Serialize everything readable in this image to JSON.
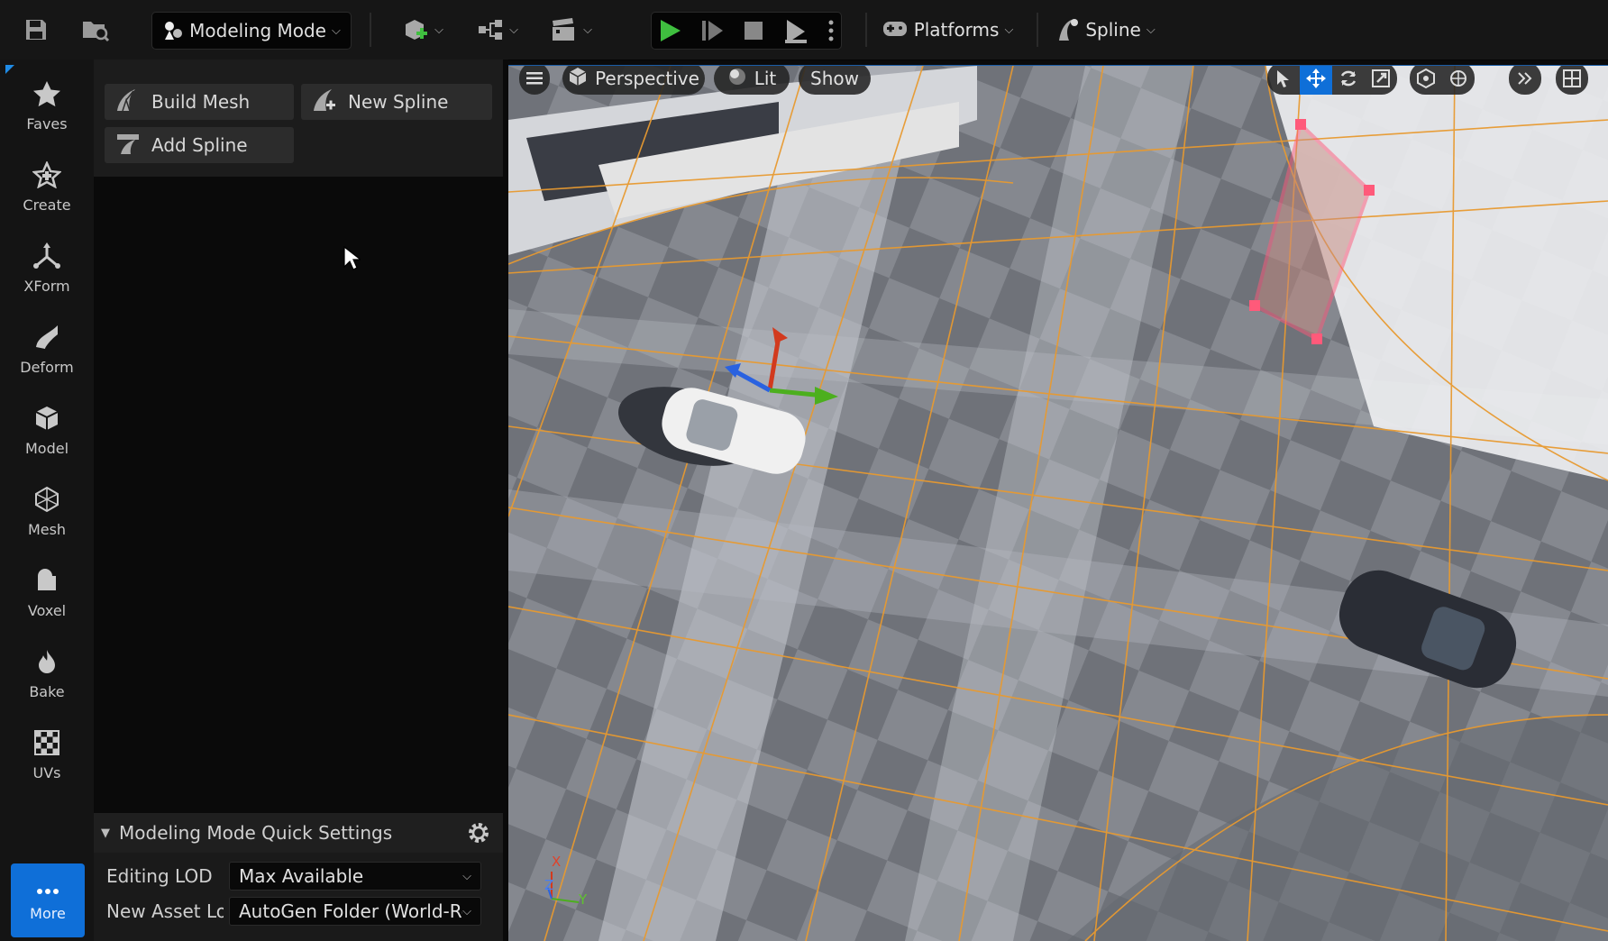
{
  "toolbar": {
    "mode_label": "Modeling Mode",
    "platforms_label": "Platforms",
    "spline_label": "Spline"
  },
  "categories": [
    {
      "label": "Faves",
      "icon": "star-icon"
    },
    {
      "label": "Create",
      "icon": "create-icon"
    },
    {
      "label": "XForm",
      "icon": "xform-icon"
    },
    {
      "label": "Deform",
      "icon": "deform-icon"
    },
    {
      "label": "Model",
      "icon": "model-icon"
    },
    {
      "label": "Mesh",
      "icon": "mesh-icon"
    },
    {
      "label": "Voxel",
      "icon": "voxel-icon"
    },
    {
      "label": "Bake",
      "icon": "bake-icon"
    },
    {
      "label": "UVs",
      "icon": "uvs-icon"
    }
  ],
  "more_label": "More",
  "tools": {
    "build_mesh": "Build Mesh",
    "new_spline": "New Spline",
    "add_spline": "Add Spline"
  },
  "quick_settings": {
    "title": "Modeling Mode Quick Settings",
    "rows": [
      {
        "label": "Editing LOD",
        "value": "Max Available"
      },
      {
        "label": "New Asset Loca",
        "value": "AutoGen Folder (World-Re"
      }
    ]
  },
  "viewport": {
    "perspective_label": "Perspective",
    "lit_label": "Lit",
    "show_label": "Show",
    "axis_labels": {
      "x": "X",
      "y": "Y",
      "z": "Z"
    }
  },
  "colors": {
    "accent": "#0f6fd8",
    "play_green": "#3fbf3f",
    "grid_orange": "#e89a30",
    "spline_pink": "#ff5a7a",
    "gizmo_red": "#d23a1e",
    "gizmo_green": "#4caf1e",
    "gizmo_blue": "#2a62e0"
  }
}
